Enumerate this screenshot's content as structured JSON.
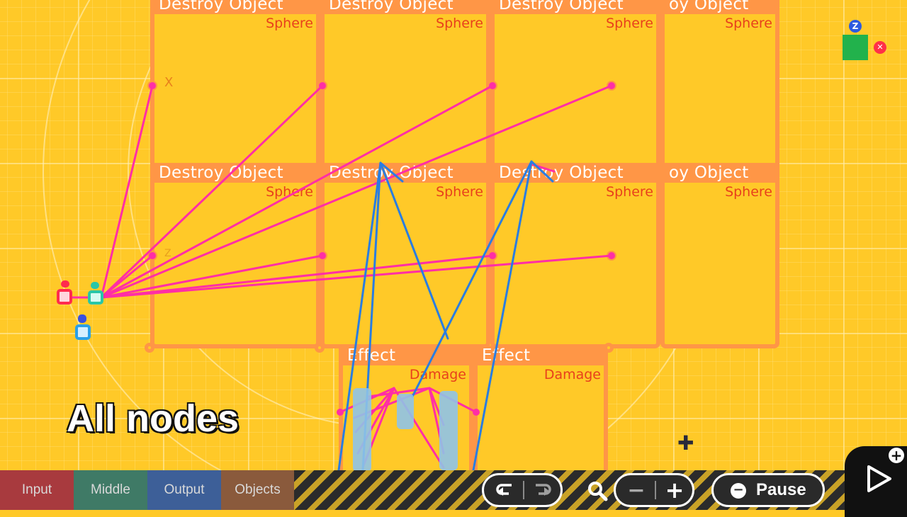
{
  "nodes": [
    {
      "title": "Destroy Object",
      "subtitle": "Sphere"
    },
    {
      "title": "Destroy Object",
      "subtitle": "Sphere"
    },
    {
      "title": "Destroy Object",
      "subtitle": "Sphere"
    },
    {
      "title": "oy Object",
      "subtitle": "Sphere"
    },
    {
      "title": "Destroy Object",
      "subtitle": "Sphere"
    },
    {
      "title": "Destroy Object",
      "subtitle": "Sphere"
    },
    {
      "title": "Destroy Object",
      "subtitle": "Sphere"
    },
    {
      "title": "oy Object",
      "subtitle": "Sphere"
    },
    {
      "title": "Effect",
      "subtitle": "Damage"
    },
    {
      "title": "Effect",
      "subtitle": "Damage"
    }
  ],
  "port_letters": {
    "x": "X",
    "z": "Z"
  },
  "caption": "All nodes",
  "tabs": [
    {
      "label": "Input",
      "color": "#a83a3e"
    },
    {
      "label": "Middle",
      "color": "#3f7a66"
    },
    {
      "label": "Output",
      "color": "#3d5f98"
    },
    {
      "label": "Objects",
      "color": "#8a5a3c"
    }
  ],
  "toolbar": {
    "undo_icon": "undo-arrow",
    "redo_icon": "redo-arrow",
    "zoom_icon": "magnifier",
    "zoom_out": "−",
    "zoom_in": "+",
    "pause_badge": "−",
    "pause_label": "Pause",
    "play_icon": "play-triangle",
    "play_badge": "+"
  },
  "corner_marker": {
    "letter": "Z",
    "close": "✕",
    "color": "#22b24c"
  },
  "wire_colors": {
    "pink": "#ff2ea6",
    "blue": "#2a7de1"
  }
}
